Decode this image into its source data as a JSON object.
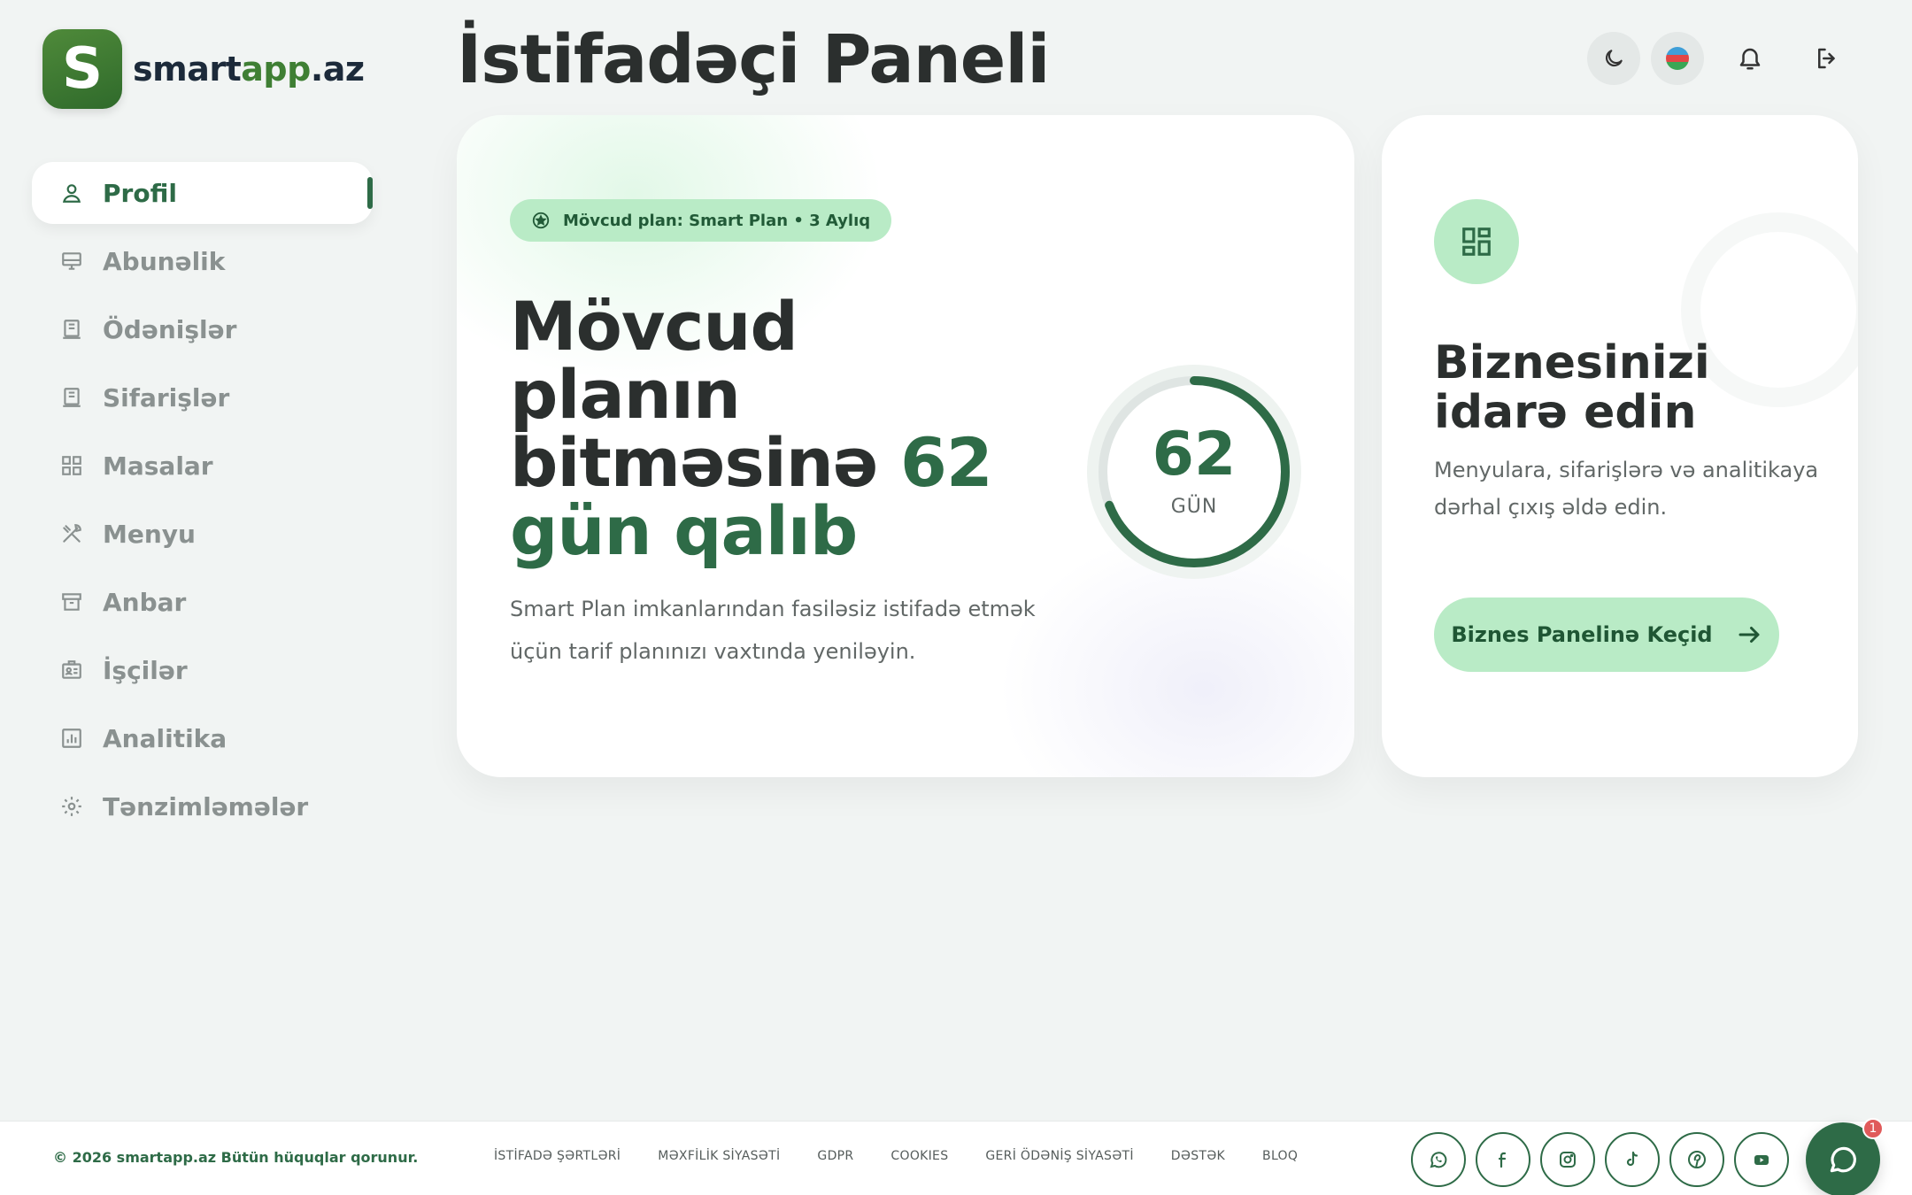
{
  "brand": {
    "initial": "S",
    "name_part1": "smart",
    "name_part2": "app",
    "name_part3": ".az"
  },
  "page_title": "İstifadəçi Paneli",
  "header": {
    "theme_icon": "moon-icon",
    "language_flag": "azerbaijan-flag",
    "notifications_icon": "bell-icon",
    "logout_icon": "logout-icon"
  },
  "sidebar": {
    "items": [
      {
        "label": "Profil",
        "icon": "user-icon",
        "active": true
      },
      {
        "label": "Abunəlik",
        "icon": "monitor-icon",
        "active": false
      },
      {
        "label": "Ödənişlər",
        "icon": "receipt-icon",
        "active": false
      },
      {
        "label": "Sifarişlər",
        "icon": "receipt-icon",
        "active": false
      },
      {
        "label": "Masalar",
        "icon": "grid-icon",
        "active": false
      },
      {
        "label": "Menyu",
        "icon": "utensils-icon",
        "active": false
      },
      {
        "label": "Anbar",
        "icon": "archive-icon",
        "active": false
      },
      {
        "label": "İşçilər",
        "icon": "id-card-icon",
        "active": false
      },
      {
        "label": "Analitika",
        "icon": "chart-icon",
        "active": false
      },
      {
        "label": "Tənzimləmələr",
        "icon": "gear-icon",
        "active": false
      }
    ]
  },
  "plan": {
    "badge": "Mövcud plan: Smart Plan • 3 Aylıq",
    "heading_line1": "Mövcud",
    "heading_line2": "planın",
    "heading_line3_text": "bitməsinə",
    "heading_days": "62",
    "heading_line4": "gün qalıb",
    "description": "Smart Plan imkanlarından fasiləsiz istifadə etmək üçün tarif planınızı vaxtında yeniləyin.",
    "ring_value": "62",
    "ring_label": "GÜN",
    "ring_progress": 0.69
  },
  "business": {
    "title": "Biznesinizi idarə edin",
    "description": "Menyulara, sifarişlərə və analitikaya dərhal çıxış əldə edin.",
    "button_label": "Biznes Panelinə Keçid"
  },
  "footer": {
    "copyright": "© 2026 smartapp.az Bütün hüquqlar qorunur.",
    "links": [
      "İSTİFADƏ ŞƏRTLƏRİ",
      "MƏXFİLİK SİYASƏTİ",
      "GDPR",
      "COOKIES",
      "GERİ ÖDƏNİŞ SİYASƏTİ",
      "DƏSTƏK",
      "BLOQ"
    ],
    "socials": [
      "whatsapp-icon",
      "facebook-icon",
      "instagram-icon",
      "tiktok-icon",
      "pinterest-icon",
      "youtube-icon"
    ]
  },
  "chat": {
    "badge_count": "1"
  },
  "colors": {
    "accent": "#2e6b47",
    "accent_light": "#b9ebc6",
    "background": "#f1f4f3"
  }
}
